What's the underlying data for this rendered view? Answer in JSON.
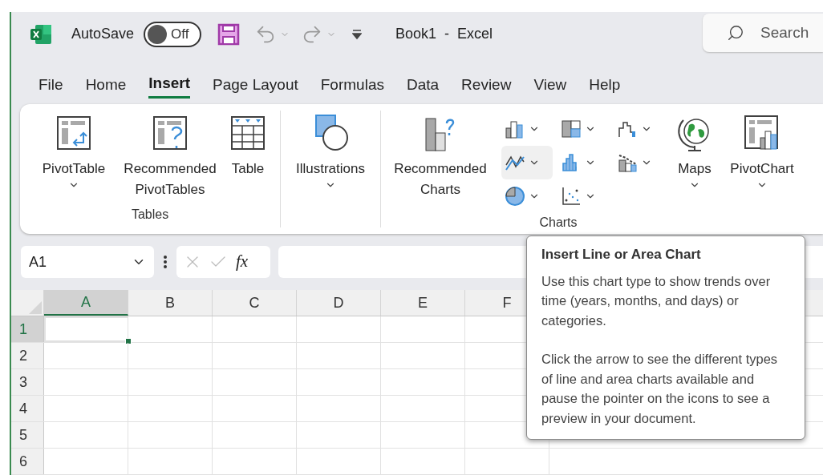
{
  "titlebar": {
    "autosave": {
      "label": "AutoSave",
      "on": false,
      "state_text": "Off"
    },
    "title": "Book1  -  Excel",
    "search": {
      "placeholder": "Search"
    }
  },
  "tabs": [
    {
      "label": "File",
      "selected": false
    },
    {
      "label": "Home",
      "selected": false
    },
    {
      "label": "Insert",
      "selected": true
    },
    {
      "label": "Page Layout",
      "selected": false
    },
    {
      "label": "Formulas",
      "selected": false
    },
    {
      "label": "Data",
      "selected": false
    },
    {
      "label": "Review",
      "selected": false
    },
    {
      "label": "View",
      "selected": false
    },
    {
      "label": "Help",
      "selected": false
    }
  ],
  "ribbon": {
    "groups": [
      {
        "label": "Tables",
        "buttons": [
          {
            "kind": "pivottable",
            "label": "PivotTable",
            "dropdown": true
          },
          {
            "kind": "recommended-pivot",
            "label": "Recommended\nPivotTables",
            "dropdown": false
          },
          {
            "kind": "table",
            "label": "Table",
            "dropdown": false
          }
        ]
      },
      {
        "buttons": [
          {
            "kind": "illustrations",
            "label": "Illustrations",
            "dropdown": true
          }
        ]
      },
      {
        "label": "Charts",
        "buttons": [
          {
            "kind": "recommended-charts",
            "label": "Recommended\nCharts",
            "dropdown": false
          }
        ],
        "gallery": [
          {
            "kind": "column",
            "highlighted": false
          },
          {
            "kind": "hierarchy",
            "highlighted": false
          },
          {
            "kind": "waterfall",
            "highlighted": false
          },
          {
            "kind": "line",
            "highlighted": true
          },
          {
            "kind": "bar",
            "highlighted": false
          },
          {
            "kind": "combo",
            "highlighted": false
          },
          {
            "kind": "pie",
            "highlighted": false
          },
          {
            "kind": "scatter",
            "highlighted": false
          }
        ],
        "after": [
          {
            "kind": "maps",
            "label": "Maps",
            "dropdown": true
          },
          {
            "kind": "pivotchart",
            "label": "PivotChart",
            "dropdown": true
          }
        ]
      }
    ]
  },
  "formula_bar": {
    "name_box": "A1",
    "fx": "fx"
  },
  "grid": {
    "columns": [
      {
        "label": "A",
        "selected": true
      },
      {
        "label": "B",
        "selected": false
      },
      {
        "label": "C",
        "selected": false
      },
      {
        "label": "D",
        "selected": false
      },
      {
        "label": "E",
        "selected": false
      },
      {
        "label": "F",
        "selected": false
      }
    ],
    "rows": [
      {
        "label": "1",
        "selected": true
      },
      {
        "label": "2",
        "selected": false
      },
      {
        "label": "3",
        "selected": false
      },
      {
        "label": "4",
        "selected": false
      },
      {
        "label": "5",
        "selected": false
      },
      {
        "label": "6",
        "selected": false
      }
    ]
  },
  "tooltip": {
    "title": "Insert Line or Area Chart",
    "paragraphs": [
      "Use this chart type to show trends over time (years, months, and days) or categories.",
      "Click the arrow to see the different types of line and area charts available and pause the pointer on the icons to see a preview in your document."
    ]
  }
}
